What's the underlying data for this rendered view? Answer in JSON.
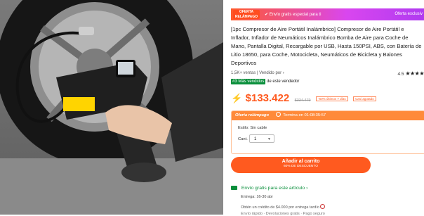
{
  "banner": {
    "flash_line1": "OFERTA",
    "flash_line2": "RELÁMPAGO",
    "free_shipping": "✔ Envío gratis especial para ti",
    "exclusive": "Oferta exclusiv"
  },
  "product": {
    "title": "[1pc Compresor de Aire Portátil Inalámbrico] Compresor de Aire Portátil e Inflador, Inflador de Neumáticos Inalámbrico Bomba de Aire para Coche de Mano, Pantalla Digital, Recargable por USB, Hasta 150PSI, ABS, con Batería de Litio 18650, para Coche, Motocicleta, Neumáticos de Bicicleta y Balones Deportivos",
    "sales": "1,5K+ ventas | Vendido por",
    "rating": "4.5",
    "stars": "★★★★",
    "bestseller_tag": "#3 Más vendidos",
    "bestseller_text": "de este vendedor",
    "price": "$133.422",
    "old_price": "$334.479",
    "discount_chip": "-60% últimos 7 días",
    "almost_sold_chip": "Casi agotado"
  },
  "flash_box": {
    "label": "Oferta relámpago",
    "timer": "Termina en 01:08:35:57",
    "style": "Estilo: Sin cable",
    "qty_label": "Cant.",
    "qty_value": "1"
  },
  "cart": {
    "label": "Añadir al carrito",
    "sub": "60% DE DESCUENTO"
  },
  "shipping": {
    "label": "Envío gratis para este artículo",
    "chevron": "›",
    "delivery": "Entrega: 16-30 abr",
    "credit": "Obtén un crédito de $4.000 por entrega tardío",
    "cut_text": "Envío rápido · Devoluciones gratis · Pago seguro"
  },
  "colors": {
    "accent": "#ff5a1f",
    "green": "#0a8f3c"
  }
}
